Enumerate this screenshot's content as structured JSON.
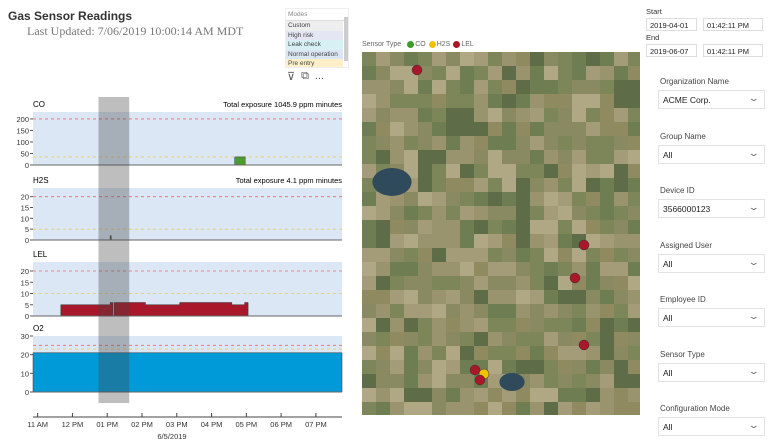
{
  "header": {
    "title": "Gas Sensor Readings",
    "last_updated": "Last Updated: 7/06/2019 10:00:14 AM MDT"
  },
  "modes": {
    "header": "Modes",
    "items": [
      {
        "label": "Custom",
        "color": "#eeeeee"
      },
      {
        "label": "High risk",
        "color": "#e4e6f4"
      },
      {
        "label": "Leak check",
        "color": "#d6f0f4"
      },
      {
        "label": "Normal operation",
        "color": "#dbe6f4"
      },
      {
        "label": "Pre entry",
        "color": "#fdf0c8"
      }
    ]
  },
  "visual_tools": {
    "filter": "filter-icon",
    "focus": "focus-mode-icon",
    "more": "..."
  },
  "map": {
    "legend_title": "Sensor Type",
    "legend": [
      {
        "label": "CO",
        "color": "#3e9b2a"
      },
      {
        "label": "H2S",
        "color": "#f2c200"
      },
      {
        "label": "LEL",
        "color": "#a8182a"
      }
    ]
  },
  "date_range": {
    "start_label": "Start",
    "start_date": "2019-04-01",
    "start_time": "01:42:11 PM",
    "end_label": "End",
    "end_date": "2019-06-07",
    "end_time": "01:42:11 PM"
  },
  "filters": [
    {
      "label": "Organization Name",
      "value": "ACME Corp."
    },
    {
      "label": "Group Name",
      "value": "All"
    },
    {
      "label": "Device ID",
      "value": "3566000123"
    },
    {
      "label": "Assigned User",
      "value": "All"
    },
    {
      "label": "Employee ID",
      "value": "All"
    },
    {
      "label": "Sensor Type",
      "value": "All"
    },
    {
      "label": "Configuration Mode",
      "value": "All"
    }
  ],
  "chart_data": [
    {
      "type": "area",
      "name": "CO",
      "annotation": "Total exposure 1045.9 ppm minutes",
      "yticks": [
        0,
        50,
        100,
        150,
        200
      ],
      "ylim": [
        0,
        230
      ],
      "thresholds": {
        "red": 200,
        "yellow": 35
      },
      "color": "#4a9d2c",
      "points": [
        [
          "16:40",
          0
        ],
        [
          "16:40",
          35
        ],
        [
          "16:58",
          35
        ],
        [
          "16:58",
          0
        ]
      ]
    },
    {
      "type": "area",
      "name": "H2S",
      "annotation": "Total exposure 4.1 ppm minutes",
      "yticks": [
        0,
        5,
        10,
        15,
        20
      ],
      "ylim": [
        0,
        24
      ],
      "thresholds": {
        "red": 20,
        "yellow": 5
      },
      "color": "#6a6a2a",
      "points": [
        [
          "13:05",
          0
        ],
        [
          "13:05",
          2
        ],
        [
          "13:07",
          2
        ],
        [
          "13:07",
          0
        ]
      ]
    },
    {
      "type": "area",
      "name": "LEL",
      "annotation": "",
      "yticks": [
        0,
        5,
        10,
        15,
        20
      ],
      "ylim": [
        0,
        24
      ],
      "thresholds": {
        "red": 20,
        "yellow": 10
      },
      "color": "#a8182a",
      "points": [
        [
          "11:40",
          0
        ],
        [
          "11:40",
          5
        ],
        [
          "13:05",
          5
        ],
        [
          "13:05",
          6
        ],
        [
          "13:10",
          6
        ],
        [
          "13:10",
          0
        ],
        [
          "13:12",
          0
        ],
        [
          "13:12",
          6
        ],
        [
          "14:06",
          6
        ],
        [
          "14:06",
          5
        ],
        [
          "15:05",
          5
        ],
        [
          "15:05",
          6
        ],
        [
          "16:35",
          6
        ],
        [
          "16:35",
          5
        ],
        [
          "16:57",
          5
        ],
        [
          "16:57",
          6
        ],
        [
          "17:03",
          6
        ],
        [
          "17:03",
          0
        ]
      ]
    },
    {
      "type": "area",
      "name": "O2",
      "annotation": "",
      "yticks": [
        0,
        10,
        20,
        30
      ],
      "ylim": [
        0,
        30
      ],
      "thresholds": {
        "red": 25,
        "yellow": 23
      },
      "color": "#009ad9",
      "points": [
        [
          "10:52",
          0
        ],
        [
          "10:52",
          21
        ],
        [
          "19:45",
          21
        ],
        [
          "19:45",
          0
        ]
      ]
    }
  ],
  "x_axis": {
    "ticks": [
      "11 AM",
      "12 PM",
      "01 PM",
      "02 PM",
      "03 PM",
      "04 PM",
      "05 PM",
      "06 PM",
      "07 PM"
    ],
    "label": "6/5/2019",
    "range": [
      "10:52",
      "19:45"
    ],
    "selection": [
      "12:45",
      "13:38"
    ]
  }
}
